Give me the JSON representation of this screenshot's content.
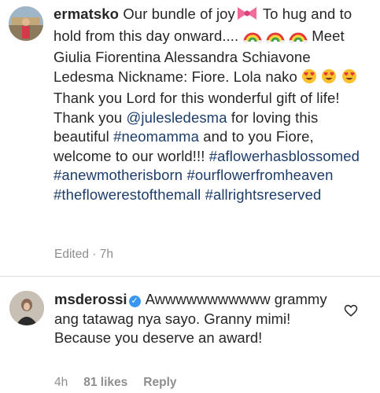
{
  "post": {
    "username": "ermatsko",
    "caption": {
      "t1": " Our bundle of joy",
      "t2": " To hug and to hold from this day onward.... ",
      "t3": " Meet Giulia Fiorentina Alessandra Schiavone Ledesma Nickname: Fiore. Lola nako",
      "t4": " Thank you Lord for this wonderful gift of life! Thank you ",
      "mention": "@julesledesma",
      "t5": " for loving this beautiful ",
      "tag1": "#neomamma",
      "t6": " and to you Fiore, welcome to our world!!! ",
      "tag2": "#aflowerhasblossomed",
      "tag3": "#anewmotherisborn",
      "tag4": "#ourflowerfromheaven",
      "tag5": "#theflowerestofthemall",
      "tag6": "#allrightsreserved"
    },
    "edited": "Edited",
    "sep": " · ",
    "time": "7h"
  },
  "comment": {
    "username": "msderossi",
    "verified_glyph": "✓",
    "text": " Awwwwwwwwwww grammy ang tatawag nya sayo. Granny mimi! Because you deserve an award!",
    "time": "4h",
    "likes": "81 likes",
    "reply": "Reply"
  },
  "icons": {
    "ribbon": "ribbon-icon",
    "rainbow": "rainbow-icon",
    "heart_eyes": "heart-eyes-icon",
    "heart": "heart-outline-icon",
    "verified": "verified-badge-icon"
  },
  "colors": {
    "hashtag": "#1c3d6a",
    "muted": "#8e8e8e",
    "verified": "#3897f0",
    "divider": "#dbdbdb"
  }
}
